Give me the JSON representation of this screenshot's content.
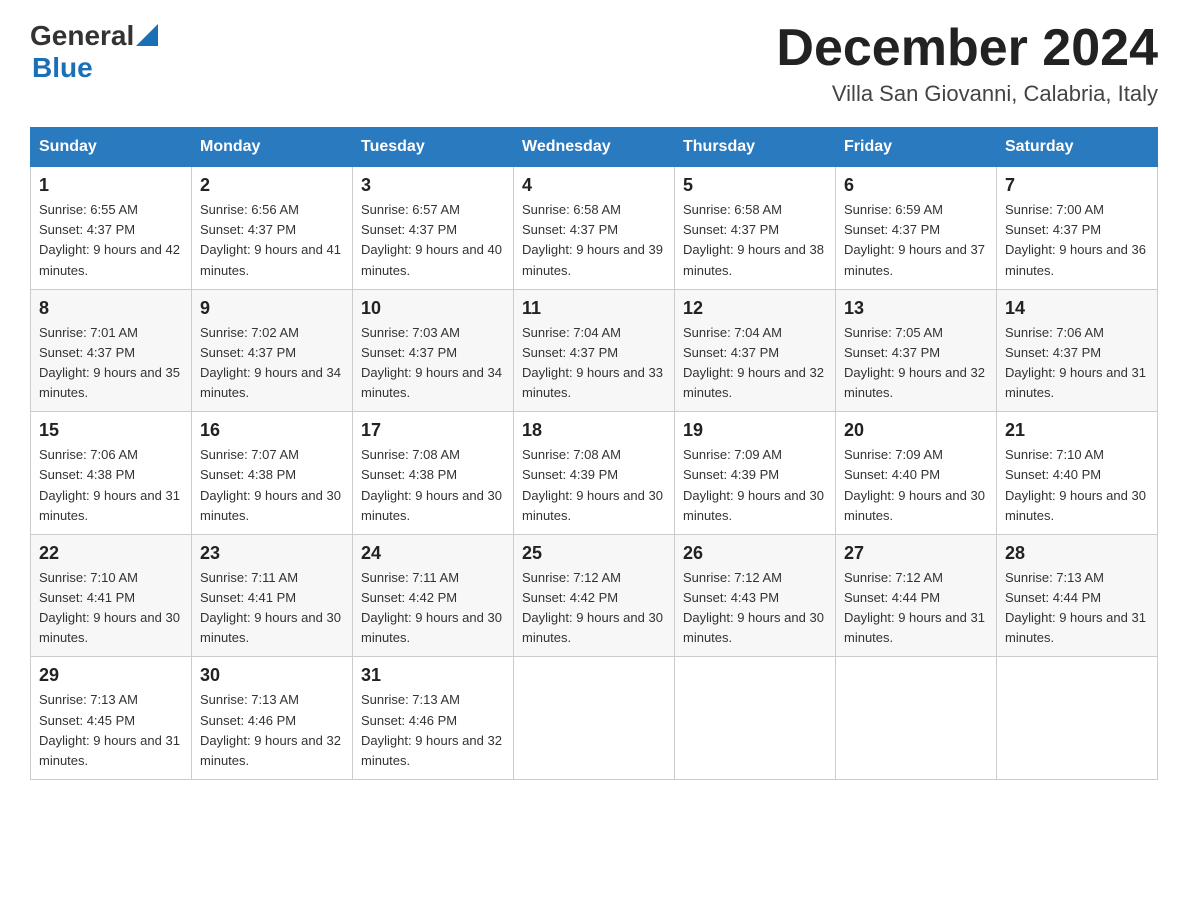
{
  "header": {
    "logo_general": "General",
    "logo_blue": "Blue",
    "title": "December 2024",
    "subtitle": "Villa San Giovanni, Calabria, Italy"
  },
  "days_of_week": [
    "Sunday",
    "Monday",
    "Tuesday",
    "Wednesday",
    "Thursday",
    "Friday",
    "Saturday"
  ],
  "weeks": [
    [
      {
        "day": "1",
        "sunrise": "6:55 AM",
        "sunset": "4:37 PM",
        "daylight": "9 hours and 42 minutes."
      },
      {
        "day": "2",
        "sunrise": "6:56 AM",
        "sunset": "4:37 PM",
        "daylight": "9 hours and 41 minutes."
      },
      {
        "day": "3",
        "sunrise": "6:57 AM",
        "sunset": "4:37 PM",
        "daylight": "9 hours and 40 minutes."
      },
      {
        "day": "4",
        "sunrise": "6:58 AM",
        "sunset": "4:37 PM",
        "daylight": "9 hours and 39 minutes."
      },
      {
        "day": "5",
        "sunrise": "6:58 AM",
        "sunset": "4:37 PM",
        "daylight": "9 hours and 38 minutes."
      },
      {
        "day": "6",
        "sunrise": "6:59 AM",
        "sunset": "4:37 PM",
        "daylight": "9 hours and 37 minutes."
      },
      {
        "day": "7",
        "sunrise": "7:00 AM",
        "sunset": "4:37 PM",
        "daylight": "9 hours and 36 minutes."
      }
    ],
    [
      {
        "day": "8",
        "sunrise": "7:01 AM",
        "sunset": "4:37 PM",
        "daylight": "9 hours and 35 minutes."
      },
      {
        "day": "9",
        "sunrise": "7:02 AM",
        "sunset": "4:37 PM",
        "daylight": "9 hours and 34 minutes."
      },
      {
        "day": "10",
        "sunrise": "7:03 AM",
        "sunset": "4:37 PM",
        "daylight": "9 hours and 34 minutes."
      },
      {
        "day": "11",
        "sunrise": "7:04 AM",
        "sunset": "4:37 PM",
        "daylight": "9 hours and 33 minutes."
      },
      {
        "day": "12",
        "sunrise": "7:04 AM",
        "sunset": "4:37 PM",
        "daylight": "9 hours and 32 minutes."
      },
      {
        "day": "13",
        "sunrise": "7:05 AM",
        "sunset": "4:37 PM",
        "daylight": "9 hours and 32 minutes."
      },
      {
        "day": "14",
        "sunrise": "7:06 AM",
        "sunset": "4:37 PM",
        "daylight": "9 hours and 31 minutes."
      }
    ],
    [
      {
        "day": "15",
        "sunrise": "7:06 AM",
        "sunset": "4:38 PM",
        "daylight": "9 hours and 31 minutes."
      },
      {
        "day": "16",
        "sunrise": "7:07 AM",
        "sunset": "4:38 PM",
        "daylight": "9 hours and 30 minutes."
      },
      {
        "day": "17",
        "sunrise": "7:08 AM",
        "sunset": "4:38 PM",
        "daylight": "9 hours and 30 minutes."
      },
      {
        "day": "18",
        "sunrise": "7:08 AM",
        "sunset": "4:39 PM",
        "daylight": "9 hours and 30 minutes."
      },
      {
        "day": "19",
        "sunrise": "7:09 AM",
        "sunset": "4:39 PM",
        "daylight": "9 hours and 30 minutes."
      },
      {
        "day": "20",
        "sunrise": "7:09 AM",
        "sunset": "4:40 PM",
        "daylight": "9 hours and 30 minutes."
      },
      {
        "day": "21",
        "sunrise": "7:10 AM",
        "sunset": "4:40 PM",
        "daylight": "9 hours and 30 minutes."
      }
    ],
    [
      {
        "day": "22",
        "sunrise": "7:10 AM",
        "sunset": "4:41 PM",
        "daylight": "9 hours and 30 minutes."
      },
      {
        "day": "23",
        "sunrise": "7:11 AM",
        "sunset": "4:41 PM",
        "daylight": "9 hours and 30 minutes."
      },
      {
        "day": "24",
        "sunrise": "7:11 AM",
        "sunset": "4:42 PM",
        "daylight": "9 hours and 30 minutes."
      },
      {
        "day": "25",
        "sunrise": "7:12 AM",
        "sunset": "4:42 PM",
        "daylight": "9 hours and 30 minutes."
      },
      {
        "day": "26",
        "sunrise": "7:12 AM",
        "sunset": "4:43 PM",
        "daylight": "9 hours and 30 minutes."
      },
      {
        "day": "27",
        "sunrise": "7:12 AM",
        "sunset": "4:44 PM",
        "daylight": "9 hours and 31 minutes."
      },
      {
        "day": "28",
        "sunrise": "7:13 AM",
        "sunset": "4:44 PM",
        "daylight": "9 hours and 31 minutes."
      }
    ],
    [
      {
        "day": "29",
        "sunrise": "7:13 AM",
        "sunset": "4:45 PM",
        "daylight": "9 hours and 31 minutes."
      },
      {
        "day": "30",
        "sunrise": "7:13 AM",
        "sunset": "4:46 PM",
        "daylight": "9 hours and 32 minutes."
      },
      {
        "day": "31",
        "sunrise": "7:13 AM",
        "sunset": "4:46 PM",
        "daylight": "9 hours and 32 minutes."
      },
      null,
      null,
      null,
      null
    ]
  ]
}
